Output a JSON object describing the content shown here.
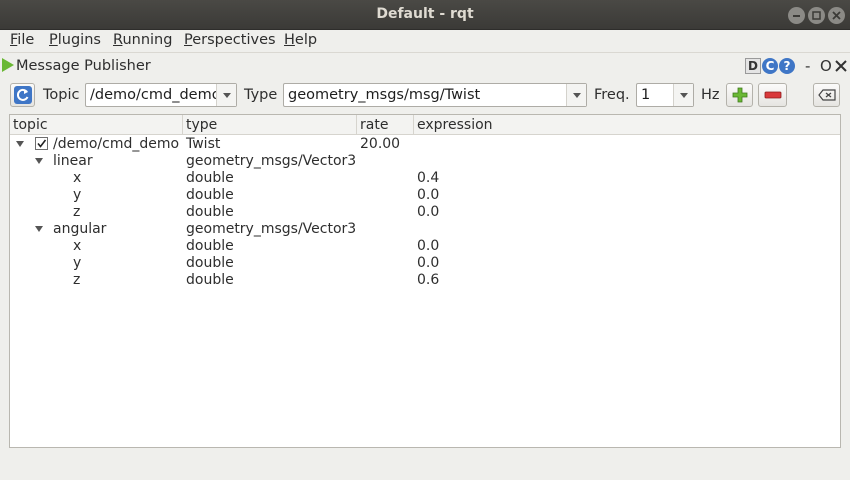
{
  "window": {
    "title": "Default - rqt"
  },
  "menu": [
    {
      "mnemonic": "F",
      "rest": "ile"
    },
    {
      "mnemonic": "P",
      "rest": "lugins"
    },
    {
      "mnemonic": "R",
      "rest": "unning"
    },
    {
      "mnemonic": "P",
      "rest": "erspectives"
    },
    {
      "mnemonic": "H",
      "rest": "elp"
    }
  ],
  "plugin": {
    "title": "Message Publisher",
    "d_label": "D",
    "c_label": "C",
    "help_label": "?",
    "minimize_label": "-",
    "close_label": "O"
  },
  "toolbar": {
    "topic_label": "Topic",
    "topic_value": "/demo/cmd_demo",
    "type_label": "Type",
    "type_value": "geometry_msgs/msg/Twist",
    "freq_label": "Freq.",
    "freq_value": "1",
    "hz_label": "Hz"
  },
  "tree": {
    "columns": [
      "topic",
      "type",
      "rate",
      "expression"
    ],
    "rows": [
      {
        "topic": "/demo/cmd_demo",
        "type": "Twist",
        "rate": "20.00",
        "expression": ""
      },
      {
        "topic": "linear",
        "type": "geometry_msgs/Vector3",
        "rate": "",
        "expression": ""
      },
      {
        "topic": "x",
        "type": "double",
        "rate": "",
        "expression": "0.4"
      },
      {
        "topic": "y",
        "type": "double",
        "rate": "",
        "expression": "0.0"
      },
      {
        "topic": "z",
        "type": "double",
        "rate": "",
        "expression": "0.0"
      },
      {
        "topic": "angular",
        "type": "geometry_msgs/Vector3",
        "rate": "",
        "expression": ""
      },
      {
        "topic": "x",
        "type": "double",
        "rate": "",
        "expression": "0.0"
      },
      {
        "topic": "y",
        "type": "double",
        "rate": "",
        "expression": "0.0"
      },
      {
        "topic": "z",
        "type": "double",
        "rate": "",
        "expression": "0.6"
      }
    ]
  },
  "colors": {
    "titlebar": "#3b3a37",
    "window_bg": "#efefec",
    "accent_green": "#6ab834",
    "remove_red": "#d9393b",
    "refresh_blue": "#3f76c6"
  }
}
